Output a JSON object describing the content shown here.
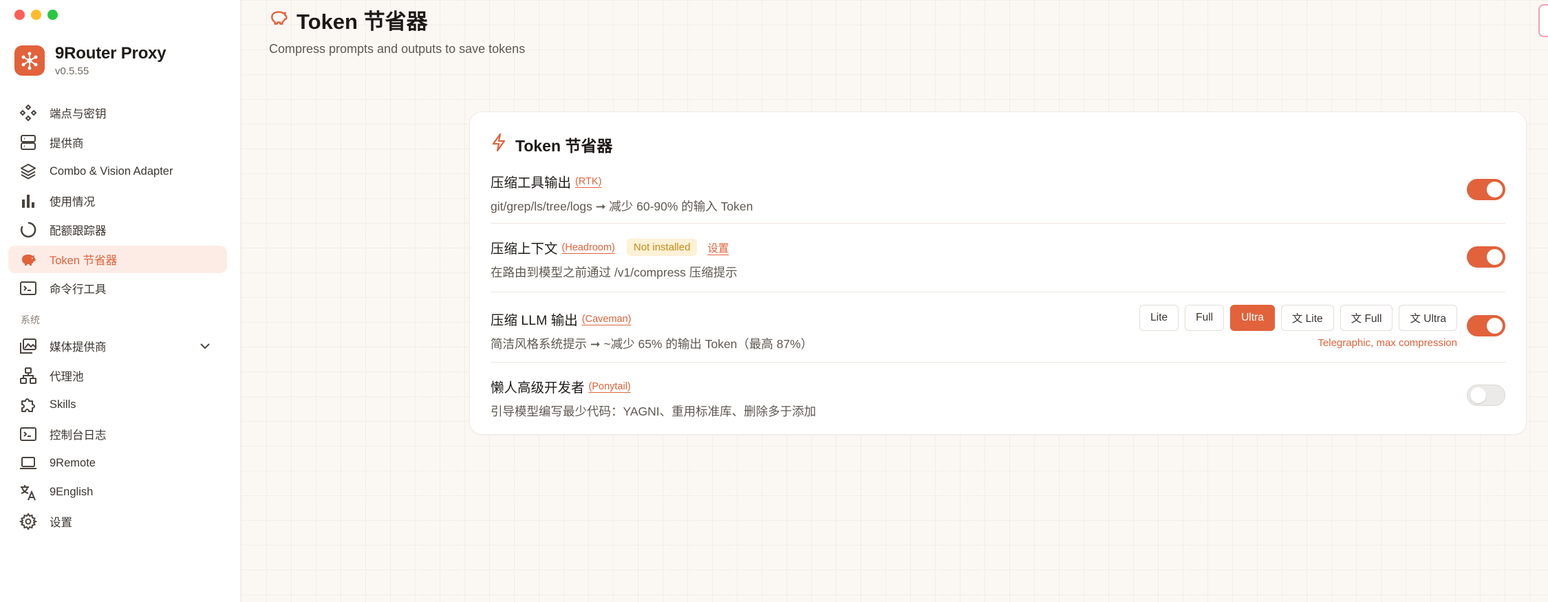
{
  "app": {
    "name": "9Router Proxy",
    "version": "v0.5.55"
  },
  "sidebar": {
    "items": [
      {
        "label": "端点与密钥",
        "icon": "endpoints-icon"
      },
      {
        "label": "提供商",
        "icon": "server-icon"
      },
      {
        "label": "Combo & Vision Adapter",
        "icon": "layers-icon"
      },
      {
        "label": "使用情况",
        "icon": "bar-chart-icon"
      },
      {
        "label": "配额跟踪器",
        "icon": "quota-ring-icon"
      },
      {
        "label": "Token 节省器",
        "icon": "piggy-bank-icon",
        "active": true
      },
      {
        "label": "命令行工具",
        "icon": "terminal-icon"
      }
    ],
    "section_label": "系统",
    "system_items": [
      {
        "label": "媒体提供商",
        "icon": "image-icon"
      },
      {
        "label": "代理池",
        "icon": "network-icon"
      },
      {
        "label": "Skills",
        "icon": "puzzle-icon"
      },
      {
        "label": "控制台日志",
        "icon": "terminal-icon"
      },
      {
        "label": "9Remote",
        "icon": "laptop-icon"
      },
      {
        "label": "9English",
        "icon": "translate-icon"
      },
      {
        "label": "设置",
        "icon": "gear-icon"
      }
    ]
  },
  "header": {
    "title": "Token 节省器",
    "subtitle": "Compress prompts and outputs to save tokens"
  },
  "card": {
    "title": "Token 节省器",
    "rows": [
      {
        "title": "压缩工具输出",
        "tag": "(RTK)",
        "desc": "git/grep/ls/tree/logs ➞ 减少 60-90% 的输入 Token",
        "enabled": true
      },
      {
        "title": "压缩上下文",
        "tag": "(Headroom)",
        "badge": "Not installed",
        "link": "设置",
        "desc": "在路由到模型之前通过 /v1/compress 压缩提示",
        "enabled": true
      },
      {
        "title": "压缩 LLM 输出",
        "tag": "(Caveman)",
        "desc": "简洁风格系统提示 ➞ ~减少 65% 的输出 Token（最高 87%）",
        "enabled": true,
        "modes": [
          "Lite",
          "Full",
          "Ultra",
          "文 Lite",
          "文 Full",
          "文 Ultra"
        ],
        "selected_mode": "Ultra",
        "mode_hint": "Telegraphic, max compression"
      },
      {
        "title": "懒人高级开发者",
        "tag": "(Ponytail)",
        "desc": "引导模型编写最少代码：YAGNI、重用标准库、删除多于添加",
        "enabled": false
      }
    ]
  },
  "colors": {
    "accent": "#e2623b",
    "active_bg": "#fdece6",
    "badge_bg": "#fdf1d6",
    "badge_text": "#c88a1a"
  }
}
